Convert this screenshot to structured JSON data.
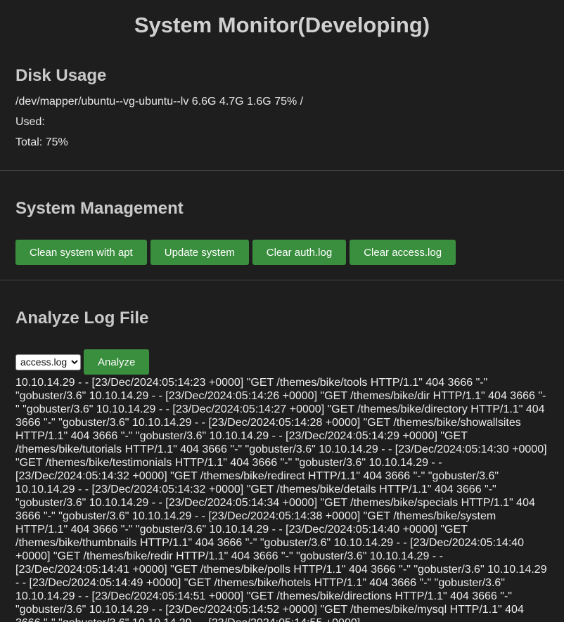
{
  "page": {
    "title": "System Monitor(Developing)"
  },
  "disk": {
    "heading": "Disk Usage",
    "device_line": "/dev/mapper/ubuntu--vg-ubuntu--lv 6.6G 4.7G 1.6G 75% /",
    "used_line": "Used:",
    "total_line": "Total: 75%"
  },
  "management": {
    "heading": "System Management",
    "buttons": [
      {
        "label": "Clean system with apt"
      },
      {
        "label": "Update system"
      },
      {
        "label": "Clear auth.log"
      },
      {
        "label": "Clear access.log"
      }
    ]
  },
  "log": {
    "heading": "Analyze Log File",
    "selected_file": "access.log",
    "analyze_label": "Analyze",
    "output": "10.10.14.29 - - [23/Dec/2024:05:14:23 +0000] \"GET /themes/bike/tools HTTP/1.1\" 404 3666 \"-\" \"gobuster/3.6\" 10.10.14.29 - - [23/Dec/2024:05:14:26 +0000] \"GET /themes/bike/dir HTTP/1.1\" 404 3666 \"-\" \"gobuster/3.6\" 10.10.14.29 - - [23/Dec/2024:05:14:27 +0000] \"GET /themes/bike/directory HTTP/1.1\" 404 3666 \"-\" \"gobuster/3.6\" 10.10.14.29 - - [23/Dec/2024:05:14:28 +0000] \"GET /themes/bike/showallsites HTTP/1.1\" 404 3666 \"-\" \"gobuster/3.6\" 10.10.14.29 - - [23/Dec/2024:05:14:29 +0000] \"GET /themes/bike/tutorials HTTP/1.1\" 404 3666 \"-\" \"gobuster/3.6\" 10.10.14.29 - - [23/Dec/2024:05:14:30 +0000] \"GET /themes/bike/testimonials HTTP/1.1\" 404 3666 \"-\" \"gobuster/3.6\" 10.10.14.29 - - [23/Dec/2024:05:14:32 +0000] \"GET /themes/bike/redirect HTTP/1.1\" 404 3666 \"-\" \"gobuster/3.6\" 10.10.14.29 - - [23/Dec/2024:05:14:32 +0000] \"GET /themes/bike/details HTTP/1.1\" 404 3666 \"-\" \"gobuster/3.6\" 10.10.14.29 - - [23/Dec/2024:05:14:34 +0000] \"GET /themes/bike/specials HTTP/1.1\" 404 3666 \"-\" \"gobuster/3.6\" 10.10.14.29 - - [23/Dec/2024:05:14:38 +0000] \"GET /themes/bike/system HTTP/1.1\" 404 3666 \"-\" \"gobuster/3.6\" 10.10.14.29 - - [23/Dec/2024:05:14:40 +0000] \"GET /themes/bike/thumbnails HTTP/1.1\" 404 3666 \"-\" \"gobuster/3.6\" 10.10.14.29 - - [23/Dec/2024:05:14:40 +0000] \"GET /themes/bike/redir HTTP/1.1\" 404 3666 \"-\" \"gobuster/3.6\" 10.10.14.29 - - [23/Dec/2024:05:14:41 +0000] \"GET /themes/bike/polls HTTP/1.1\" 404 3666 \"-\" \"gobuster/3.6\" 10.10.14.29 - - [23/Dec/2024:05:14:49 +0000] \"GET /themes/bike/hotels HTTP/1.1\" 404 3666 \"-\" \"gobuster/3.6\" 10.10.14.29 - - [23/Dec/2024:05:14:51 +0000] \"GET /themes/bike/directions HTTP/1.1\" 404 3666 \"-\" \"gobuster/3.6\" 10.10.14.29 - - [23/Dec/2024:05:14:52 +0000] \"GET /themes/bike/mysql HTTP/1.1\" 404 3666 \"-\" \"gobuster/3.6\" 10.10.14.29 - - [23/Dec/2024:05:14:55 +0000]"
  },
  "colors": {
    "background": "#1e1e1e",
    "button_green": "#3a8f3e",
    "heading_gray": "#c9c9c9"
  }
}
